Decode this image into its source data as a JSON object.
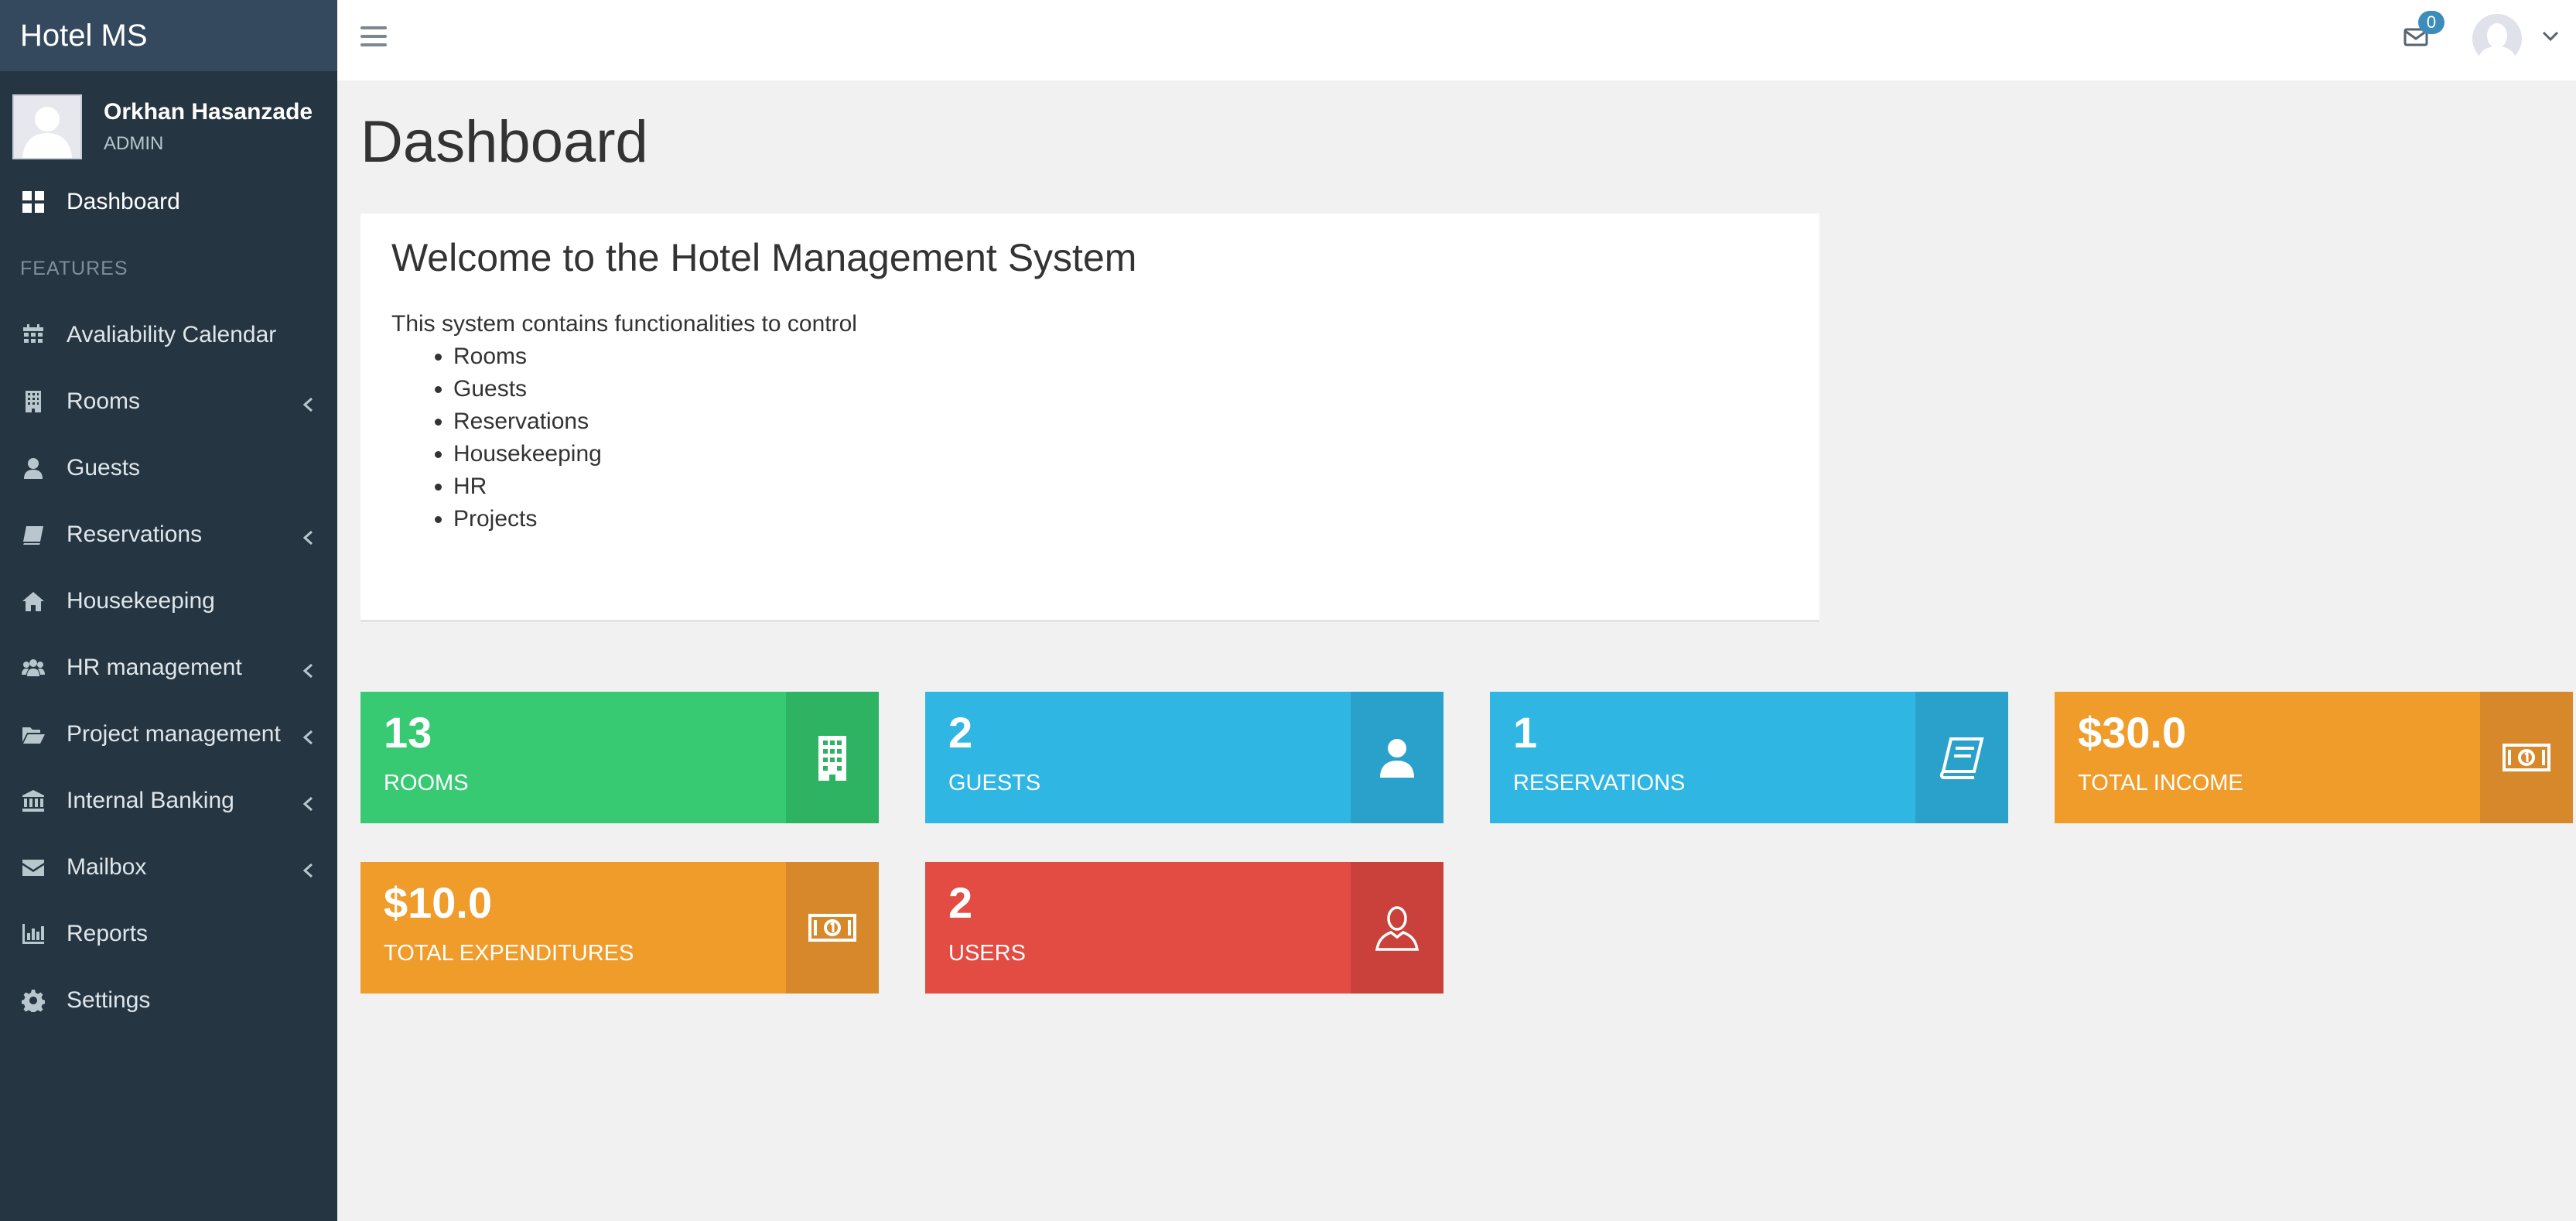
{
  "app": {
    "brand": "Hotel MS"
  },
  "user": {
    "name": "Orkhan Hasanzade",
    "role": "ADMIN"
  },
  "sidebar": {
    "items": [
      {
        "label": "Dashboard",
        "icon": "dashboard-icon",
        "active": true
      },
      {
        "header": "FEATURES"
      },
      {
        "label": "Avaliability Calendar",
        "icon": "calendar-icon"
      },
      {
        "label": "Rooms",
        "icon": "building-icon",
        "expandable": true
      },
      {
        "label": "Guests",
        "icon": "user-icon"
      },
      {
        "label": "Reservations",
        "icon": "book-icon",
        "expandable": true
      },
      {
        "label": "Housekeeping",
        "icon": "home-icon"
      },
      {
        "label": "HR management",
        "icon": "users-icon",
        "expandable": true
      },
      {
        "label": "Project management",
        "icon": "folder-open-icon",
        "expandable": true
      },
      {
        "label": "Internal Banking",
        "icon": "bank-icon",
        "expandable": true
      },
      {
        "label": "Mailbox",
        "icon": "envelope-icon",
        "expandable": true
      },
      {
        "label": "Reports",
        "icon": "bar-chart-icon"
      },
      {
        "label": "Settings",
        "icon": "gear-icon"
      }
    ]
  },
  "topbar": {
    "mail_count": "0"
  },
  "page": {
    "title": "Dashboard",
    "welcome": {
      "title": "Welcome to the Hotel Management System",
      "intro": "This system contains functionalities to control",
      "items": [
        "Rooms",
        "Guests",
        "Reservations",
        "Housekeeping",
        "HR",
        "Projects"
      ]
    }
  },
  "stats": [
    {
      "value": "13",
      "label": "ROOMS",
      "color": "#37ca73",
      "icon": "building-icon"
    },
    {
      "value": "2",
      "label": "GUESTS",
      "color": "#30b6e3",
      "icon": "user-icon"
    },
    {
      "value": "1",
      "label": "RESERVATIONS",
      "color": "#30b6e3",
      "icon": "book-icon"
    },
    {
      "value": "$30.0",
      "label": "TOTAL INCOME",
      "color": "#f09c2b",
      "icon": "money-icon"
    },
    {
      "value": "$10.0",
      "label": "TOTAL EXPENDITURES",
      "color": "#f09c2b",
      "icon": "money-icon"
    },
    {
      "value": "2",
      "label": "USERS",
      "color": "#e24c43",
      "icon": "user-outline-icon"
    }
  ]
}
